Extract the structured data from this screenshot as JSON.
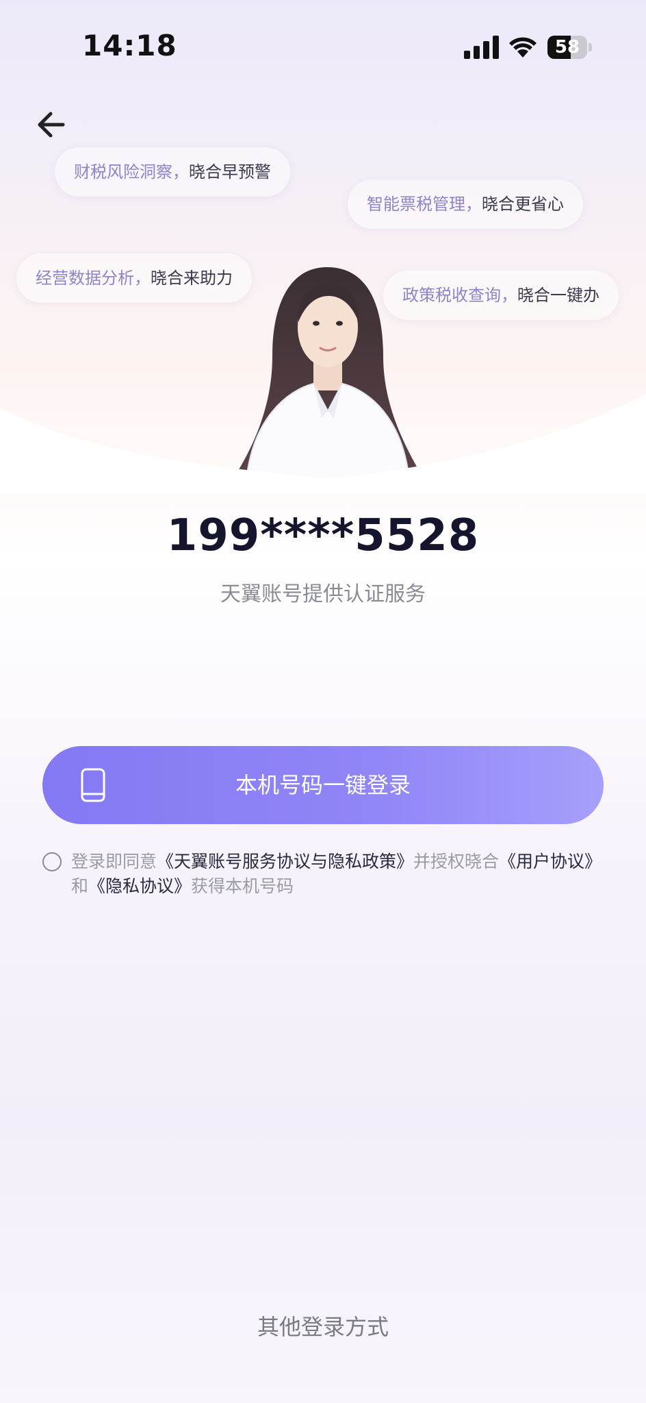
{
  "status_bar": {
    "time": "14:18",
    "battery": "58",
    "battery_level": 0.58
  },
  "bubbles": [
    {
      "keyword": "财税风险洞察，",
      "value": "晓合早预警"
    },
    {
      "keyword": "智能票税管理，",
      "value": "晓合更省心"
    },
    {
      "keyword": "经营数据分析，",
      "value": "晓合来助力"
    },
    {
      "keyword": "政策税收查询，",
      "value": "晓合一键办"
    }
  ],
  "account": {
    "phone": "199****5528",
    "provider": "天翼账号提供认证服务"
  },
  "login_button": {
    "label": "本机号码一键登录"
  },
  "agreement": {
    "prefix": "登录即同意",
    "service_link": "《天翼账号服务协议与隐私政策》",
    "middle": "并授权晓合",
    "user_link": "《用户协议》",
    "and": "和",
    "privacy_link": "《隐私协议》",
    "suffix": "获得本机号码"
  },
  "other_login": "其他登录方式",
  "colors": {
    "accent": "#8479f3",
    "bubble_keyword": "#8e84c7",
    "phone_text": "#15152e"
  }
}
